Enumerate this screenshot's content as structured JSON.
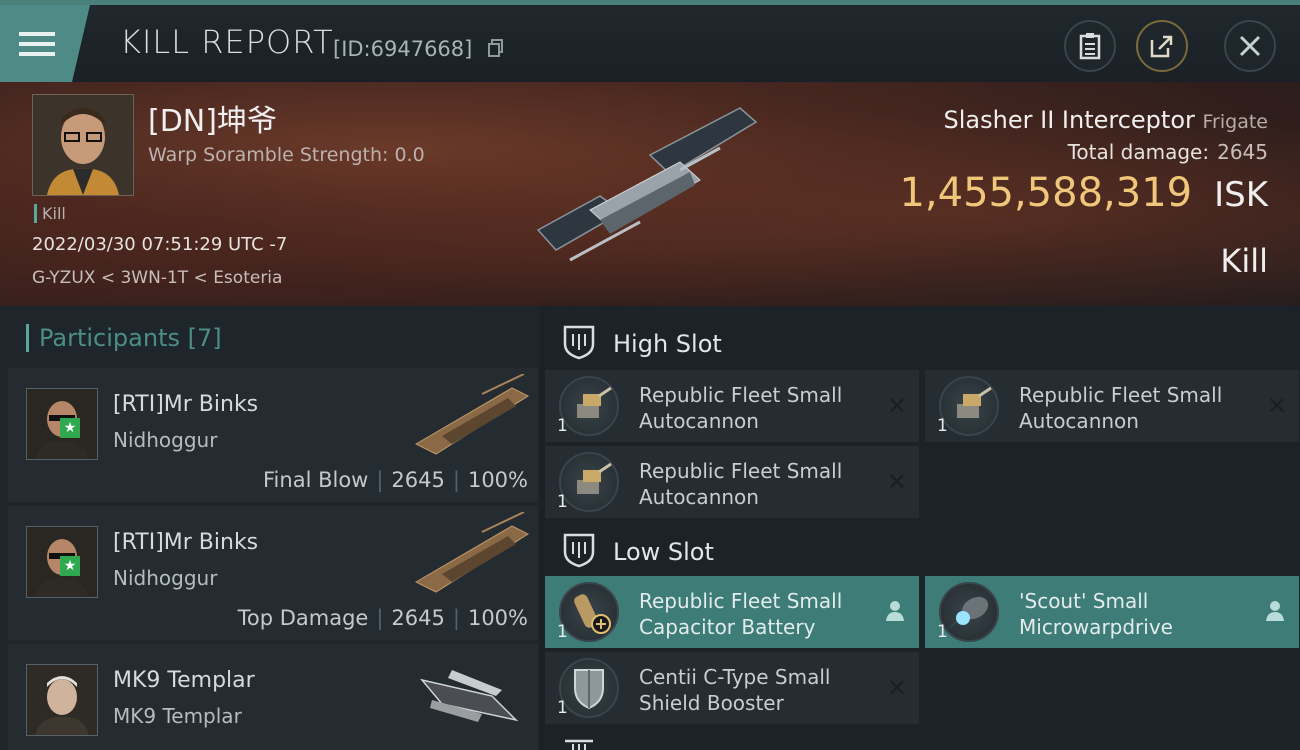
{
  "header": {
    "title": "KILL REPORT",
    "report_id": "[ID:6947668]"
  },
  "victim": {
    "name": "[DN]坤爷",
    "warp_scramble": "Warp Soramble Strength: 0.0",
    "tag": "Kill",
    "datetime": "2022/03/30 07:51:29 UTC -7",
    "location": "G-YZUX < 3WN-1T < Esoteria",
    "ship_name": "Slasher II Interceptor",
    "ship_class": "Frigate",
    "total_damage_label": "Total damage:",
    "total_damage": "2645",
    "isk_value": "1,455,588,319",
    "isk_unit": "ISK",
    "result": "Kill"
  },
  "participants": {
    "header": "Participants [7]",
    "rows": [
      {
        "pilot": "[RTI]Mr Binks",
        "ship": "Nidhoggur",
        "role": "Final Blow",
        "damage": "2645",
        "percent": "100%"
      },
      {
        "pilot": "[RTI]Mr Binks",
        "ship": "Nidhoggur",
        "role": "Top Damage",
        "damage": "2645",
        "percent": "100%"
      },
      {
        "pilot": "MK9 Templar",
        "ship": "MK9 Templar",
        "role": "",
        "damage": "",
        "percent": ""
      }
    ]
  },
  "fitting": {
    "high_slot_label": "High Slot",
    "low_slot_label": "Low Slot",
    "high": [
      {
        "qty": "1",
        "line1": "Republic Fleet Small",
        "line2": "Autocannon",
        "state": "destroyed"
      },
      {
        "qty": "1",
        "line1": "Republic Fleet Small",
        "line2": "Autocannon",
        "state": "destroyed"
      },
      {
        "qty": "1",
        "line1": "Republic Fleet Small",
        "line2": "Autocannon",
        "state": "destroyed"
      }
    ],
    "low": [
      {
        "qty": "1",
        "line1": "Republic Fleet Small",
        "line2": "Capacitor Battery",
        "state": "dropped"
      },
      {
        "qty": "1",
        "line1": "'Scout' Small",
        "line2": "Microwarpdrive",
        "state": "dropped"
      },
      {
        "qty": "1",
        "line1": "Centii C-Type Small",
        "line2": "Shield Booster",
        "state": "destroyed"
      }
    ]
  },
  "colors": {
    "accent": "#4e8b86",
    "isk": "#f0c77a",
    "dropped_bg": "#3e7c77",
    "assist_star": "#2fa84f"
  },
  "icons": [
    "menu-icon",
    "copy-icon",
    "clipboard-icon",
    "share-icon",
    "close-icon",
    "shield-slot-icon",
    "autocannon-icon",
    "capacitor-icon",
    "microwarpdrive-icon",
    "shield-booster-icon",
    "person-icon",
    "x-icon",
    "star-icon"
  ]
}
